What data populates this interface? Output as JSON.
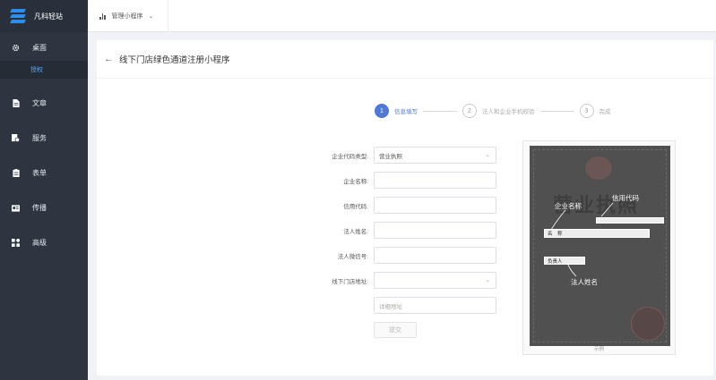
{
  "sidebar": {
    "brand": "凡科轻站",
    "items": [
      {
        "label": "桌面",
        "icon": "gear-icon"
      },
      {
        "label": "文章",
        "icon": "document-icon"
      },
      {
        "label": "服务",
        "icon": "service-icon"
      },
      {
        "label": "表单",
        "icon": "clipboard-icon"
      },
      {
        "label": "传播",
        "icon": "id-card-icon"
      },
      {
        "label": "高级",
        "icon": "grid-icon"
      }
    ],
    "sub_item": "授权"
  },
  "topbar": {
    "app_switch_label": "管理小程序",
    "app_switch_icon": "bar-chart-icon"
  },
  "page": {
    "title": "线下门店绿色通道注册小程序"
  },
  "steps": [
    {
      "num": "1",
      "label": "信息填写",
      "active": true
    },
    {
      "num": "2",
      "label": "法人和企业手机校验",
      "active": false
    },
    {
      "num": "3",
      "label": "完成",
      "active": false
    }
  ],
  "form": {
    "fields": [
      {
        "label": "企业代码类型:",
        "value": "营业执照",
        "type": "select"
      },
      {
        "label": "企业名称:",
        "value": "",
        "type": "input"
      },
      {
        "label": "信用代码:",
        "value": "",
        "type": "input"
      },
      {
        "label": "法人姓名:",
        "value": "",
        "type": "input"
      },
      {
        "label": "法人微信号:",
        "value": "",
        "type": "input"
      },
      {
        "label": "线下门店地址:",
        "value": "",
        "type": "select"
      }
    ],
    "detail_placeholder": "详细地址",
    "submit_label": "提交"
  },
  "sample": {
    "license_title": "营业执照",
    "annotation_company": "企业名称",
    "annotation_credit": "信用代码",
    "annotation_legal": "法人姓名",
    "field_name": "名　称",
    "field_owner": "负责人",
    "caption": "示例"
  },
  "colors": {
    "sidebar_bg": "#2e3541",
    "accent": "#4f79d6"
  }
}
